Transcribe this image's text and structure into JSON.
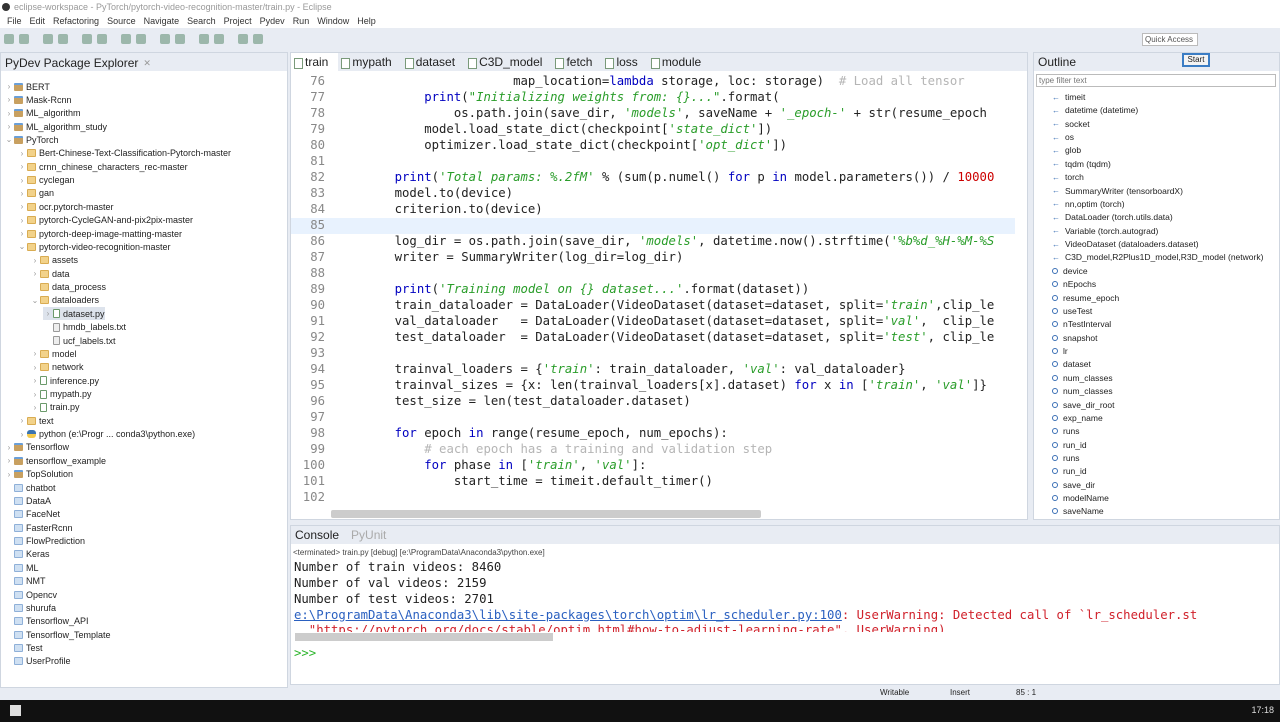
{
  "window": {
    "title": "eclipse-workspace - PyTorch/pytorch-video-recognition-master/train.py - Eclipse"
  },
  "menu": [
    "File",
    "Edit",
    "Refactoring",
    "Source",
    "Navigate",
    "Search",
    "Project",
    "Pydev",
    "Run",
    "Window",
    "Help"
  ],
  "quick_access": {
    "placeholder": "Quick Access",
    "tooltip": "Start"
  },
  "explorer": {
    "title": "PyDev Package Explorer",
    "items": [
      {
        "level": 0,
        "arrow": ">",
        "icon": "project",
        "label": "BERT"
      },
      {
        "level": 0,
        "arrow": ">",
        "icon": "project",
        "label": "Mask-Rcnn"
      },
      {
        "level": 0,
        "arrow": ">",
        "icon": "project",
        "label": "ML_algorithm"
      },
      {
        "level": 0,
        "arrow": ">",
        "icon": "project",
        "label": "ML_algorithm_study"
      },
      {
        "level": 0,
        "arrow": "v",
        "icon": "project",
        "label": "PyTorch"
      },
      {
        "level": 1,
        "arrow": ">",
        "icon": "folder",
        "label": "Bert-Chinese-Text-Classification-Pytorch-master"
      },
      {
        "level": 1,
        "arrow": ">",
        "icon": "folder",
        "label": "crnn_chinese_characters_rec-master"
      },
      {
        "level": 1,
        "arrow": ">",
        "icon": "folder",
        "label": "cyclegan"
      },
      {
        "level": 1,
        "arrow": ">",
        "icon": "folder",
        "label": "gan"
      },
      {
        "level": 1,
        "arrow": ">",
        "icon": "folder",
        "label": "ocr.pytorch-master"
      },
      {
        "level": 1,
        "arrow": ">",
        "icon": "folder",
        "label": "pytorch-CycleGAN-and-pix2pix-master"
      },
      {
        "level": 1,
        "arrow": ">",
        "icon": "folder",
        "label": "pytorch-deep-image-matting-master"
      },
      {
        "level": 1,
        "arrow": "v",
        "icon": "folder",
        "label": "pytorch-video-recognition-master"
      },
      {
        "level": 2,
        "arrow": ">",
        "icon": "folder",
        "label": "assets"
      },
      {
        "level": 2,
        "arrow": ">",
        "icon": "folder",
        "label": "data"
      },
      {
        "level": 2,
        "arrow": "",
        "icon": "folder",
        "label": "data_process"
      },
      {
        "level": 2,
        "arrow": "v",
        "icon": "folder",
        "label": "dataloaders"
      },
      {
        "level": 3,
        "arrow": ">",
        "icon": "pyfile",
        "label": "dataset.py",
        "selected": true
      },
      {
        "level": 3,
        "arrow": "",
        "icon": "txtfile",
        "label": "hmdb_labels.txt"
      },
      {
        "level": 3,
        "arrow": "",
        "icon": "txtfile",
        "label": "ucf_labels.txt"
      },
      {
        "level": 2,
        "arrow": ">",
        "icon": "folder",
        "label": "model"
      },
      {
        "level": 2,
        "arrow": ">",
        "icon": "folder",
        "label": "network"
      },
      {
        "level": 2,
        "arrow": ">",
        "icon": "pyfile",
        "label": "inference.py"
      },
      {
        "level": 2,
        "arrow": ">",
        "icon": "pyfile",
        "label": "mypath.py"
      },
      {
        "level": 2,
        "arrow": ">",
        "icon": "pyfile",
        "label": "train.py"
      },
      {
        "level": 1,
        "arrow": ">",
        "icon": "folder",
        "label": "text"
      },
      {
        "level": 1,
        "arrow": ">",
        "icon": "python",
        "label": "python  (e:\\Progr ... conda3\\python.exe)"
      },
      {
        "level": 0,
        "arrow": ">",
        "icon": "project",
        "label": "Tensorflow"
      },
      {
        "level": 0,
        "arrow": ">",
        "icon": "project",
        "label": "tensorflow_example"
      },
      {
        "level": 0,
        "arrow": ">",
        "icon": "project",
        "label": "TopSolution"
      },
      {
        "level": 0,
        "arrow": "",
        "icon": "plainfolder",
        "label": "chatbot"
      },
      {
        "level": 0,
        "arrow": "",
        "icon": "plainfolder",
        "label": "DataA"
      },
      {
        "level": 0,
        "arrow": "",
        "icon": "plainfolder",
        "label": "FaceNet"
      },
      {
        "level": 0,
        "arrow": "",
        "icon": "plainfolder",
        "label": "FasterRcnn"
      },
      {
        "level": 0,
        "arrow": "",
        "icon": "plainfolder",
        "label": "FlowPrediction"
      },
      {
        "level": 0,
        "arrow": "",
        "icon": "plainfolder",
        "label": "Keras"
      },
      {
        "level": 0,
        "arrow": "",
        "icon": "plainfolder",
        "label": "ML"
      },
      {
        "level": 0,
        "arrow": "",
        "icon": "plainfolder",
        "label": "NMT"
      },
      {
        "level": 0,
        "arrow": "",
        "icon": "plainfolder",
        "label": "Opencv"
      },
      {
        "level": 0,
        "arrow": "",
        "icon": "plainfolder",
        "label": "shurufa"
      },
      {
        "level": 0,
        "arrow": "",
        "icon": "plainfolder",
        "label": "Tensorflow_API"
      },
      {
        "level": 0,
        "arrow": "",
        "icon": "plainfolder",
        "label": "Tensorflow_Template"
      },
      {
        "level": 0,
        "arrow": "",
        "icon": "plainfolder",
        "label": "Test"
      },
      {
        "level": 0,
        "arrow": "",
        "icon": "plainfolder",
        "label": "UserProfile"
      }
    ]
  },
  "editor": {
    "tabs": [
      "train",
      "mypath",
      "dataset",
      "C3D_model",
      "fetch",
      "loss",
      "module"
    ],
    "active_tab": "train",
    "current_line": 85,
    "lines": [
      {
        "n": "76",
        "t": [
          [
            "p",
            "                    map_location="
          ],
          [
            "kw",
            "lambda"
          ],
          [
            "p",
            " storage, loc: storage)  "
          ],
          [
            "cm",
            "# Load all tensor"
          ]
        ]
      },
      {
        "n": "77",
        "t": [
          [
            "p",
            "        "
          ],
          [
            "kw",
            "print"
          ],
          [
            "p",
            "("
          ],
          [
            "st",
            "\"Initializing weights from: {}...\""
          ],
          [
            "p",
            ".format("
          ]
        ]
      },
      {
        "n": "78",
        "t": [
          [
            "p",
            "            os.path.join(save_dir, "
          ],
          [
            "st",
            "'models'"
          ],
          [
            "p",
            ", saveName + "
          ],
          [
            "st",
            "'_epoch-'"
          ],
          [
            "p",
            " + str(resume_epoch"
          ]
        ]
      },
      {
        "n": "79",
        "t": [
          [
            "p",
            "        model.load_state_dict(checkpoint["
          ],
          [
            "st",
            "'state_dict'"
          ],
          [
            "p",
            "])"
          ]
        ]
      },
      {
        "n": "80",
        "t": [
          [
            "p",
            "        optimizer.load_state_dict(checkpoint["
          ],
          [
            "st",
            "'opt_dict'"
          ],
          [
            "p",
            "])"
          ]
        ]
      },
      {
        "n": "81",
        "t": []
      },
      {
        "n": "82",
        "t": [
          [
            "p",
            "    "
          ],
          [
            "kw",
            "print"
          ],
          [
            "p",
            "("
          ],
          [
            "st",
            "'Total params: %.2fM'"
          ],
          [
            "p",
            " % (sum(p.numel() "
          ],
          [
            "kw",
            "for"
          ],
          [
            "p",
            " p "
          ],
          [
            "kw",
            "in"
          ],
          [
            "p",
            " model.parameters()) / "
          ],
          [
            "nm",
            "10000"
          ]
        ]
      },
      {
        "n": "83",
        "t": [
          [
            "p",
            "    model.to(device)"
          ]
        ]
      },
      {
        "n": "84",
        "t": [
          [
            "p",
            "    criterion.to(device)"
          ]
        ]
      },
      {
        "n": "85",
        "t": []
      },
      {
        "n": "86",
        "t": [
          [
            "p",
            "    log_dir = os.path.join(save_dir, "
          ],
          [
            "st",
            "'models'"
          ],
          [
            "p",
            ", datetime.now().strftime("
          ],
          [
            "st",
            "'%b%d_%H-%M-%S"
          ]
        ]
      },
      {
        "n": "87",
        "t": [
          [
            "p",
            "    writer = SummaryWriter(log_dir=log_dir)"
          ]
        ]
      },
      {
        "n": "88",
        "t": []
      },
      {
        "n": "89",
        "t": [
          [
            "p",
            "    "
          ],
          [
            "kw",
            "print"
          ],
          [
            "p",
            "("
          ],
          [
            "st",
            "'Training model on {} dataset...'"
          ],
          [
            "p",
            ".format(dataset))"
          ]
        ]
      },
      {
        "n": "90",
        "t": [
          [
            "p",
            "    train_dataloader = DataLoader(VideoDataset(dataset=dataset, split="
          ],
          [
            "st",
            "'train'"
          ],
          [
            "p",
            ",clip_le"
          ]
        ]
      },
      {
        "n": "91",
        "t": [
          [
            "p",
            "    val_dataloader   = DataLoader(VideoDataset(dataset=dataset, split="
          ],
          [
            "st",
            "'val'"
          ],
          [
            "p",
            ",  clip_le"
          ]
        ]
      },
      {
        "n": "92",
        "t": [
          [
            "p",
            "    test_dataloader  = DataLoader(VideoDataset(dataset=dataset, split="
          ],
          [
            "st",
            "'test'"
          ],
          [
            "p",
            ", clip_le"
          ]
        ]
      },
      {
        "n": "93",
        "t": []
      },
      {
        "n": "94",
        "t": [
          [
            "p",
            "    trainval_loaders = {"
          ],
          [
            "st",
            "'train'"
          ],
          [
            "p",
            ": train_dataloader, "
          ],
          [
            "st",
            "'val'"
          ],
          [
            "p",
            ": val_dataloader}"
          ]
        ]
      },
      {
        "n": "95",
        "t": [
          [
            "p",
            "    trainval_sizes = {x: len(trainval_loaders[x].dataset) "
          ],
          [
            "kw",
            "for"
          ],
          [
            "p",
            " x "
          ],
          [
            "kw",
            "in"
          ],
          [
            "p",
            " ["
          ],
          [
            "st",
            "'train'"
          ],
          [
            "p",
            ", "
          ],
          [
            "st",
            "'val'"
          ],
          [
            "p",
            "]}"
          ]
        ]
      },
      {
        "n": "96",
        "t": [
          [
            "p",
            "    test_size = len(test_dataloader.dataset)"
          ]
        ]
      },
      {
        "n": "97",
        "t": []
      },
      {
        "n": "98",
        "t": [
          [
            "p",
            "    "
          ],
          [
            "kw",
            "for"
          ],
          [
            "p",
            " epoch "
          ],
          [
            "kw",
            "in"
          ],
          [
            "p",
            " range(resume_epoch, num_epochs):"
          ]
        ]
      },
      {
        "n": "99",
        "t": [
          [
            "p",
            "        "
          ],
          [
            "cm",
            "# each epoch has a training and validation step"
          ]
        ]
      },
      {
        "n": "100",
        "t": [
          [
            "p",
            "        "
          ],
          [
            "kw",
            "for"
          ],
          [
            "p",
            " phase "
          ],
          [
            "kw",
            "in"
          ],
          [
            "p",
            " ["
          ],
          [
            "st",
            "'train'"
          ],
          [
            "p",
            ", "
          ],
          [
            "st",
            "'val'"
          ],
          [
            "p",
            "]:"
          ]
        ]
      },
      {
        "n": "101",
        "t": [
          [
            "p",
            "            start_time = timeit.default_timer()"
          ]
        ]
      },
      {
        "n": "102",
        "t": []
      }
    ]
  },
  "outline": {
    "title": "Outline",
    "filter_placeholder": "type filter text",
    "items": [
      {
        "kind": "import",
        "label": "timeit"
      },
      {
        "kind": "import",
        "label": "datetime (datetime)"
      },
      {
        "kind": "import",
        "label": "socket"
      },
      {
        "kind": "import",
        "label": "os"
      },
      {
        "kind": "import",
        "label": "glob"
      },
      {
        "kind": "import",
        "label": "tqdm (tqdm)"
      },
      {
        "kind": "import",
        "label": "torch"
      },
      {
        "kind": "import",
        "label": "SummaryWriter (tensorboardX)"
      },
      {
        "kind": "import",
        "label": "nn,optim (torch)"
      },
      {
        "kind": "import",
        "label": "DataLoader (torch.utils.data)"
      },
      {
        "kind": "import",
        "label": "Variable (torch.autograd)"
      },
      {
        "kind": "import",
        "label": "VideoDataset (dataloaders.dataset)"
      },
      {
        "kind": "import",
        "label": "C3D_model,R2Plus1D_model,R3D_model (network)"
      },
      {
        "kind": "var",
        "label": "device"
      },
      {
        "kind": "var",
        "label": "nEpochs"
      },
      {
        "kind": "var",
        "label": "resume_epoch"
      },
      {
        "kind": "var",
        "label": "useTest"
      },
      {
        "kind": "var",
        "label": "nTestInterval"
      },
      {
        "kind": "var",
        "label": "snapshot"
      },
      {
        "kind": "var",
        "label": "lr"
      },
      {
        "kind": "var",
        "label": "dataset"
      },
      {
        "kind": "var",
        "label": "num_classes"
      },
      {
        "kind": "var",
        "label": "num_classes"
      },
      {
        "kind": "var",
        "label": "save_dir_root"
      },
      {
        "kind": "var",
        "label": "exp_name"
      },
      {
        "kind": "var",
        "label": "runs"
      },
      {
        "kind": "var",
        "label": "run_id"
      },
      {
        "kind": "var",
        "label": "runs"
      },
      {
        "kind": "var",
        "label": "run_id"
      },
      {
        "kind": "var",
        "label": "save_dir"
      },
      {
        "kind": "var",
        "label": "modelName"
      },
      {
        "kind": "var",
        "label": "saveName"
      }
    ]
  },
  "console": {
    "tabs": [
      "Console",
      "PyUnit"
    ],
    "terminated": "<terminated> train.py [debug] [e:\\ProgramData\\Anaconda3\\python.exe]",
    "lines": [
      "Number of train videos: 8460",
      "Number of val videos: 2159",
      "Number of test videos: 2701"
    ],
    "warning_link": "e:\\ProgramData\\Anaconda3\\lib\\site-packages\\torch\\optim\\lr_scheduler.py:100",
    "warning_text": ": UserWarning: Detected call of `lr_scheduler.st",
    "warning_line2": "  \"https://pytorch.org/docs/stable/optim.html#how-to-adjust-learning-rate\", UserWarning)",
    "prompt": ">>>"
  },
  "status": {
    "mode": "Writable",
    "insert": "Insert",
    "position": "85 : 1"
  },
  "taskbar": {
    "time": "17:18"
  }
}
